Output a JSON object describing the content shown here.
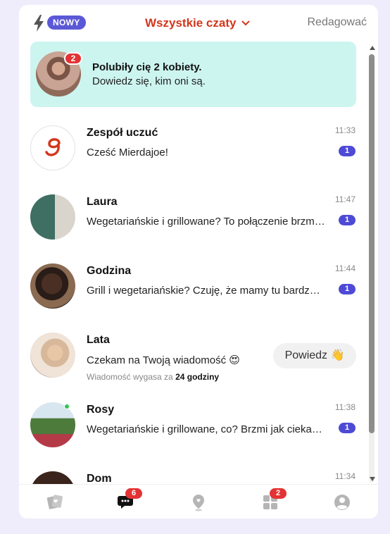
{
  "header": {
    "new_badge": "NOWY",
    "filter_label": "Wszystkie czaty",
    "edit_label": "Redagować"
  },
  "likes_banner": {
    "count": "2",
    "title": "Polubiły cię 2 kobiety.",
    "subtitle": "Dowiedz się, kim oni są."
  },
  "chats": [
    {
      "name": "Zespół uczuć",
      "message": "Cześć Mierdajoe!",
      "time": "11:33",
      "unread": "1"
    },
    {
      "name": "Laura",
      "message": "Wegetariańskie i grillowane? To połączenie brzmi ciekawie!",
      "time": "11:47",
      "unread": "1"
    },
    {
      "name": "Godzina",
      "message": "Grill i wegetariańskie? Czuję, że mamy tu bardzo dużo wspólnego",
      "time": "11:44",
      "unread": "1"
    },
    {
      "name": "Lata",
      "message": "Czekam na Twoją wiadomość 😍",
      "expire_prefix": "Wiadomość wygasa za",
      "expire_value": "24 godziny",
      "action": "Powiedz 👋"
    },
    {
      "name": "Rosy",
      "message": "Wegetariańskie i grillowane, co? Brzmi jak ciekawe połączenie",
      "time": "11:38",
      "unread": "1"
    },
    {
      "name": "Dom",
      "message": "",
      "time": "11:34"
    }
  ],
  "nav": {
    "chat_badge": "6",
    "grid_badge": "2"
  },
  "icons": {
    "new": "bolt-icon",
    "filter": "chevron-down-icon",
    "nav": [
      "cards-icon",
      "chat-icon",
      "location-heart-icon",
      "grid-icon",
      "profile-icon"
    ]
  },
  "colors": {
    "accent": "#d3361c",
    "brand": "#5b58d6",
    "badge": "#e33335",
    "likes_bg": "#cdf5f0"
  }
}
